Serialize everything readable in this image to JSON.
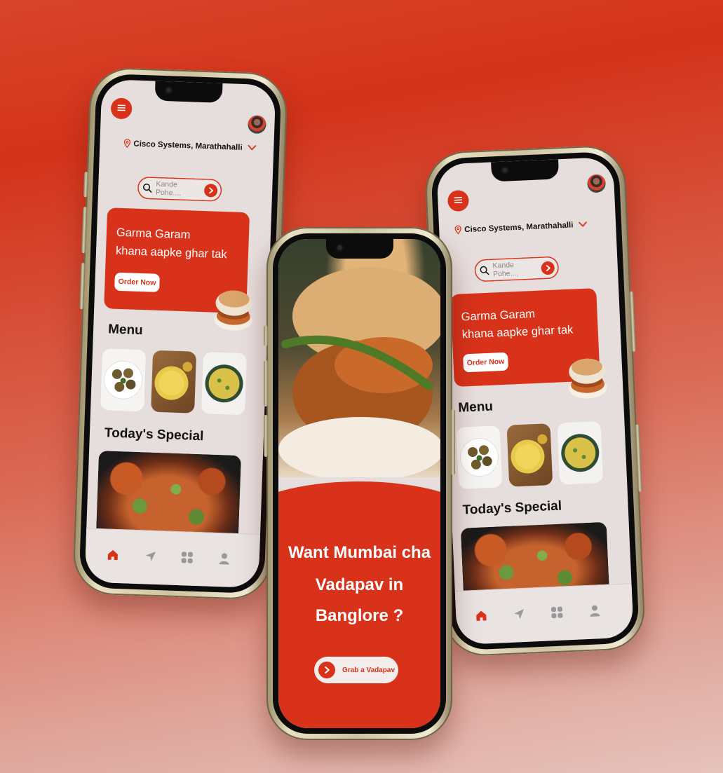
{
  "colors": {
    "accent": "#d8321a",
    "screen_bg": "#e6dedd",
    "text": "#121212"
  },
  "screens": {
    "home": {
      "menu_icon": "hamburger-icon",
      "avatar_icon": "profile-avatar",
      "location": "Cisco Systems, Marathahalli",
      "search_placeholder": "Kande Pohe....",
      "promo_line1": "Garma Garam",
      "promo_line2": "khana aapke ghar tak",
      "order_button": "Order Now",
      "menu_heading": "Menu",
      "menu_items": [
        "vada-dish",
        "dhokla-dish",
        "poha-dish"
      ],
      "special_heading": "Today's Special",
      "tabs": [
        "home-icon",
        "send-icon",
        "grid-icon",
        "user-icon"
      ]
    },
    "landing": {
      "headline_line1": "Want Mumbai cha",
      "headline_line2": "Vadapav in",
      "headline_line3": "Banglore ?",
      "cta_label": "Grab a Vadapav"
    }
  }
}
